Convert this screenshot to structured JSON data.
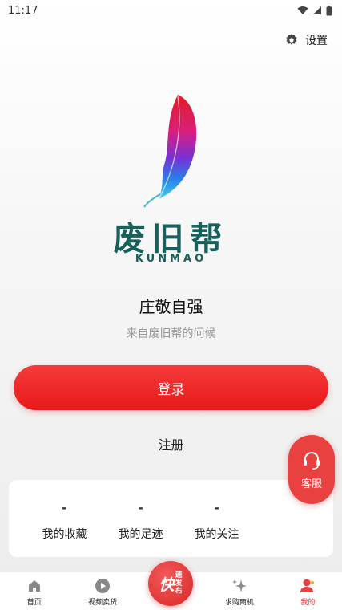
{
  "status_bar": {
    "time": "11:17"
  },
  "header": {
    "settings_label": "设置",
    "settings_icon": "gear-icon"
  },
  "logo": {
    "name": "废旧帮",
    "subtitle": "KUNMAO",
    "icon": "feather-icon"
  },
  "greeting": {
    "title": "庄敬自强",
    "subtitle": "来自废旧帮的问候"
  },
  "actions": {
    "login_label": "登录",
    "register_label": "注册"
  },
  "customer_service": {
    "label": "客服",
    "icon": "headset-icon"
  },
  "stats": [
    {
      "value": "-",
      "label": "我的收藏"
    },
    {
      "value": "-",
      "label": "我的足迹"
    },
    {
      "value": "-",
      "label": "我的关注"
    }
  ],
  "tabbar": {
    "tabs": [
      {
        "label": "首页",
        "icon": "home-icon"
      },
      {
        "label": "视频卖货",
        "icon": "play-icon"
      },
      {
        "label": "",
        "icon": "publish-icon"
      },
      {
        "label": "求购商机",
        "icon": "sparkle-icon"
      },
      {
        "label": "我的",
        "icon": "user-icon"
      }
    ],
    "publish": {
      "main": "快",
      "side_top": "速",
      "side_mid": "发",
      "side_bottom": "布"
    },
    "accent_color": "#e8413f"
  }
}
